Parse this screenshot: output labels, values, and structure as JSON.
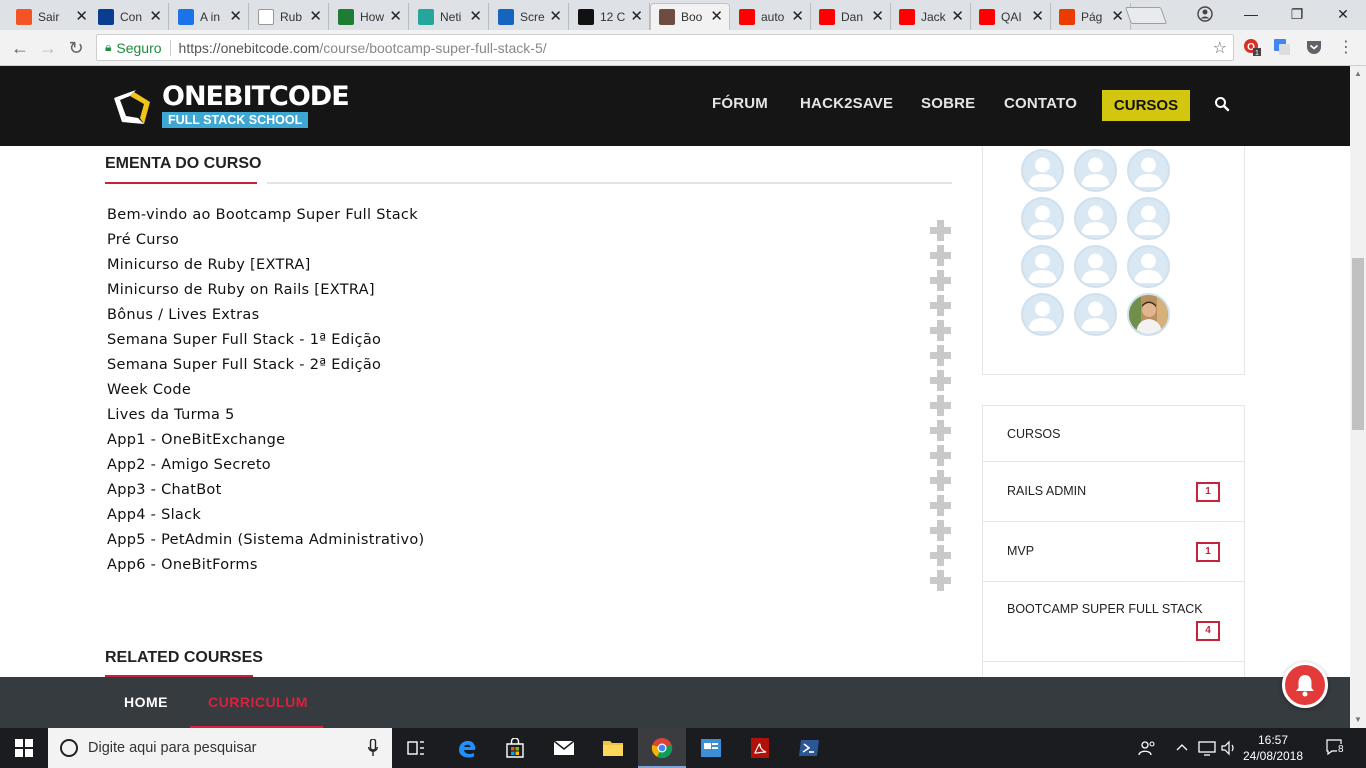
{
  "browser": {
    "tabs": [
      {
        "title": "Sair",
        "color": "#f35325"
      },
      {
        "title": "Con",
        "color": "#0a3d8f"
      },
      {
        "title": "A in",
        "color": "#1a73e8"
      },
      {
        "title": "Rub",
        "color": "#ffffff"
      },
      {
        "title": "How",
        "color": "#1e7d32"
      },
      {
        "title": "Neti",
        "color": "#26a69a"
      },
      {
        "title": "Scre",
        "color": "#1565c0"
      },
      {
        "title": "12 C",
        "color": "#111111"
      },
      {
        "title": "Boo",
        "color": "#6d4c41"
      },
      {
        "title": "auto",
        "color": "#ff0000"
      },
      {
        "title": "Dan",
        "color": "#ff0000"
      },
      {
        "title": "Jack",
        "color": "#ff0000"
      },
      {
        "title": "QAI",
        "color": "#ff0000"
      },
      {
        "title": "Pág",
        "color": "#eb3c00"
      }
    ],
    "active_tab_index": 8,
    "close_glyph": "✕",
    "secure_label": "Seguro",
    "url_host": "https://onebitcode.com",
    "url_path": "/course/bootcamp-super-full-stack-5/",
    "ext_badge": "1"
  },
  "site": {
    "logo_word": "ONEBITCODE",
    "logo_sub": "FULL STACK SCHOOL",
    "nav": [
      "FÓRUM",
      "HACK2SAVE",
      "SOBRE",
      "CONTATO"
    ],
    "nav_cta": "CURSOS",
    "brand_yellow": "#d3c60e",
    "brand_red": "#c6223c"
  },
  "curriculum": {
    "title": "EMENTA DO CURSO",
    "lessons": [
      "Bem-vindo ao Bootcamp Super Full Stack",
      "Pré Curso",
      "Minicurso de Ruby [EXTRA]",
      "Minicurso de Ruby on Rails [EXTRA]",
      "Bônus / Lives Extras",
      "Semana Super Full Stack - 1ª Edição",
      "Semana Super Full Stack - 2ª Edição",
      "Week Code",
      "Lives da Turma 5",
      "App1 - OneBitExchange",
      "App2 - Amigo Secreto",
      "App3 - ChatBot",
      "App4 - Slack",
      "App5 - PetAdmin (Sistema Administrativo)",
      "App6 - OneBitForms"
    ],
    "related_title": "RELATED COURSES"
  },
  "sidebar": {
    "members_count_shown": 12,
    "categories_header": "CURSOS",
    "categories": [
      {
        "label": "RAILS ADMIN",
        "count": "1"
      },
      {
        "label": "MVP",
        "count": "1"
      },
      {
        "label": "BOOTCAMP SUPER FULL STACK",
        "count": "4"
      }
    ]
  },
  "bottom_tabs": {
    "home": "HOME",
    "curriculum": "CURRICULUM"
  },
  "taskbar": {
    "search_placeholder": "Digite aqui para pesquisar",
    "time": "16:57",
    "date": "24/08/2018",
    "notifications": "8"
  }
}
